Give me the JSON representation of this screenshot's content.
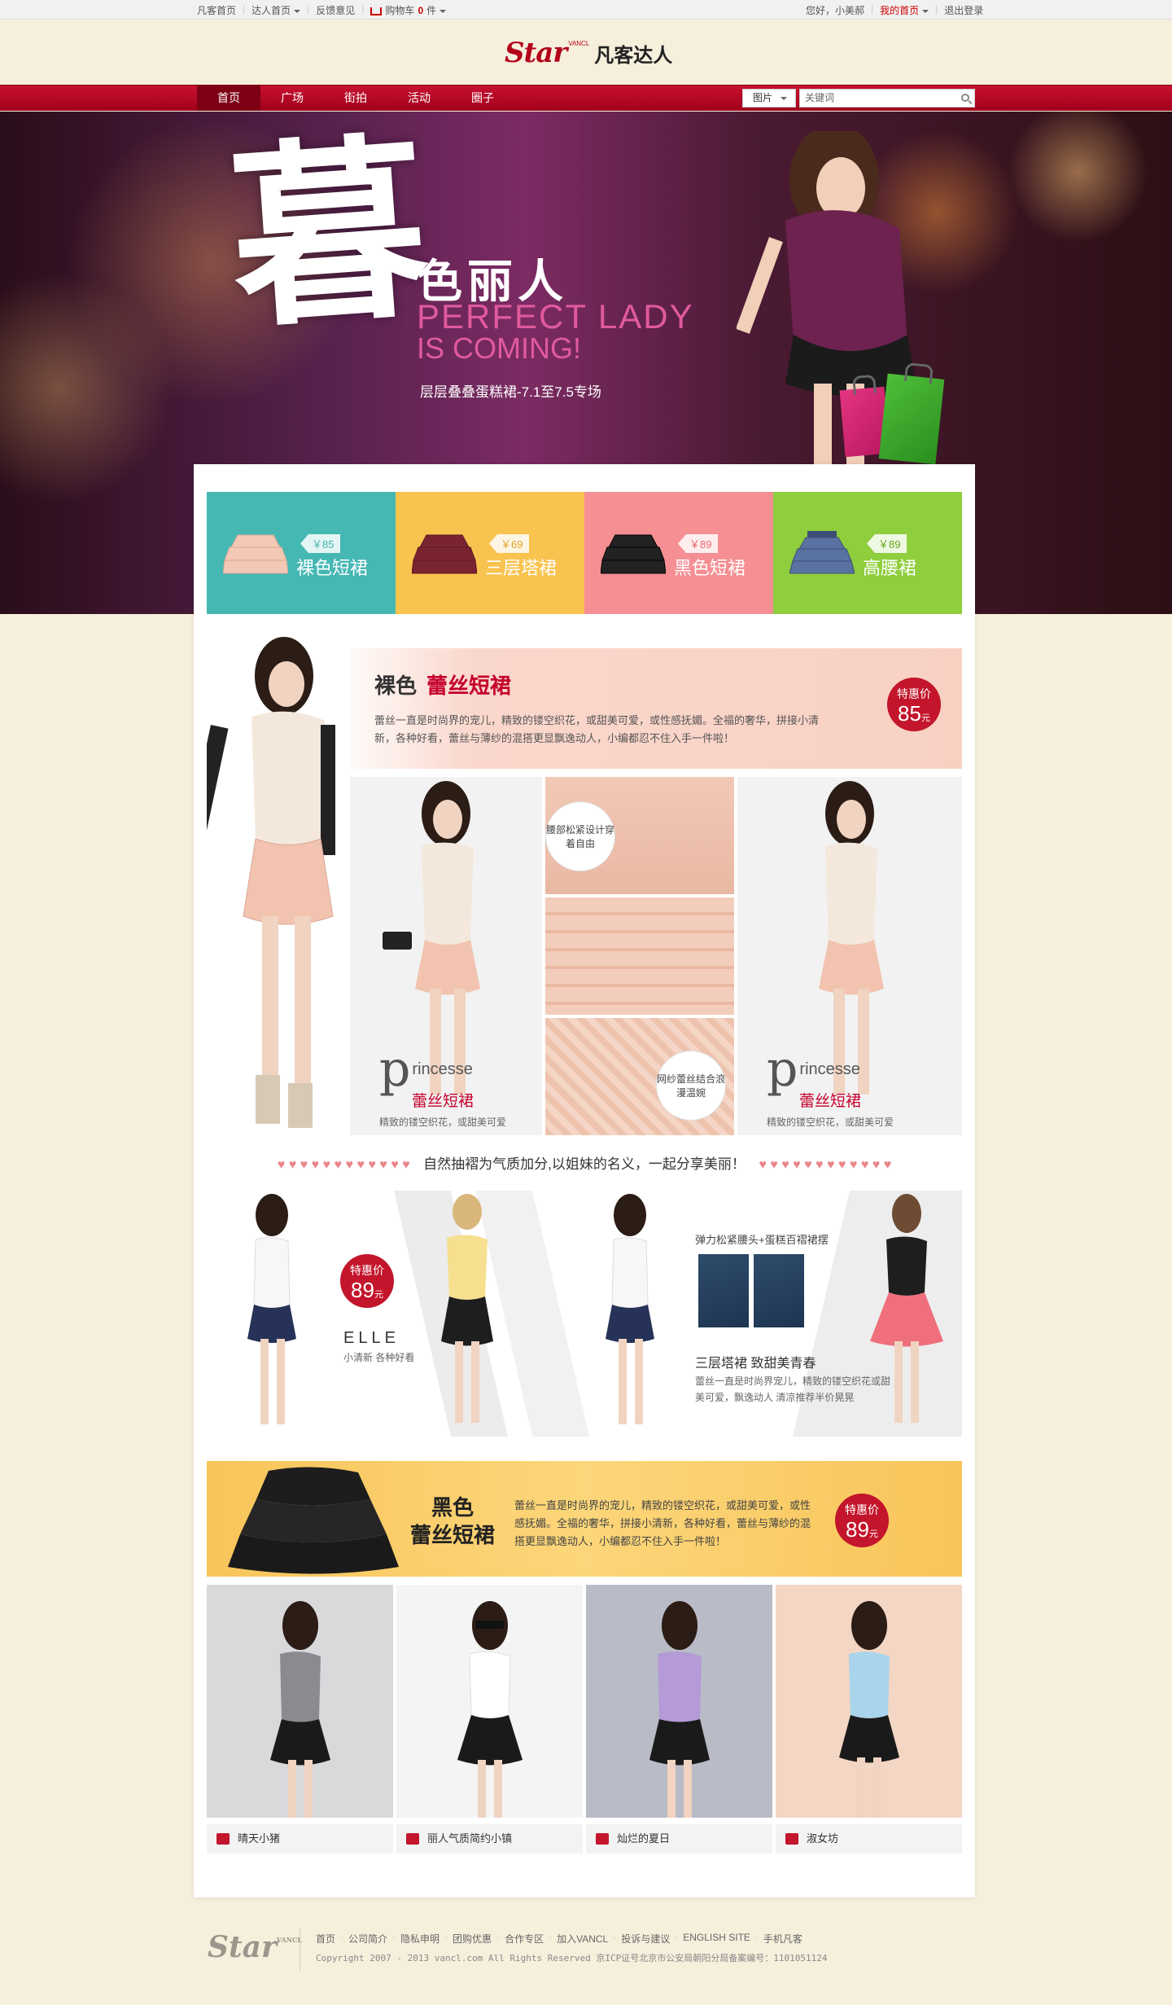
{
  "topbar": {
    "left": [
      "凡客首页",
      "达人首页",
      "反馈意见",
      "购物车",
      "0",
      "件"
    ],
    "right": [
      "您好，小美郝",
      "我的首页",
      "退出登录"
    ]
  },
  "logo": {
    "star": "Star",
    "vancl": "VANCL",
    "cn": "凡客达人"
  },
  "nav": {
    "items": [
      "首页",
      "广场",
      "街拍",
      "活动",
      "圈子"
    ],
    "search_type": "图片",
    "search_placeholder": "关键词"
  },
  "banner": {
    "big_char": "暮",
    "title": "色丽人",
    "en1": "PERFECT LADY",
    "en2": "IS COMING!",
    "subtitle": "层层叠叠蛋糕裙-7.1至7.5专场"
  },
  "tabs": [
    {
      "price": "￥85",
      "label": "裸色短裙",
      "bg": "#46b8b4",
      "skirt": "#f3c9b5"
    },
    {
      "price": "￥69",
      "label": "三层塔裙",
      "bg": "#f9c34f",
      "skirt": "#7b2431"
    },
    {
      "price": "￥89",
      "label": "黑色短裙",
      "bg": "#f58f93",
      "skirt": "#222222"
    },
    {
      "price": "￥89",
      "label": "高腰裙",
      "bg": "#8fce3d",
      "skirt": "#5a72a2"
    }
  ],
  "section1": {
    "title_a": "裸色",
    "title_b": "蕾丝短裙",
    "desc": "蕾丝一直是时尚界的宠儿，精致的镂空织花，或甜美可爱，或性感抚媚。全福的奢华，拼接小清新，各种好看，蕾丝与薄纱的混搭更显飘逸动人，小编都忍不住入手一件啦！",
    "badge_label": "特惠价",
    "badge_price": "85",
    "badge_unit": "元",
    "photo_cap_p": "p",
    "photo_cap_rincess": "rincesse",
    "photo_cap_main": "蕾丝短裙",
    "photo_cap_sub": "精致的镂空织花，或甜美可爱",
    "detail_tag1": "腰部松紧设计穿着自由",
    "detail_tag2": "网纱蕾丝结合浪漫温婉"
  },
  "hearts_text": "自然抽褶为气质加分,以姐妹的名义，一起分享美丽！",
  "section2": {
    "badge_label": "特惠价",
    "badge_price": "89",
    "badge_unit": "元",
    "elle": "ELLE",
    "elle_sub": "小清新 各种好看",
    "t1": "弹力松紧腰头+蛋糕百褶裙摆",
    "t2": "三层塔裙 致甜美青春",
    "t3": "蕾丝一直是时尚界宠儿，精致的镂空织花或甜美可爱，飘逸动人 清凉推荐半价晃晃"
  },
  "section3": {
    "title_a": "黑色",
    "title_b": "蕾丝短裙",
    "desc": "蕾丝一直是时尚界的宠儿，精致的镂空织花，或甜美可爱，或性感抚媚。全福的奢华，拼接小清新，各种好看，蕾丝与薄纱的混搭更显飘逸动人，小编都忍不住入手一件啦！",
    "badge_label": "特惠价",
    "badge_price": "89",
    "badge_unit": "元"
  },
  "cards": [
    {
      "name": "晴天小猪",
      "bg": "#d9d9dc",
      "top": "#8a8a90"
    },
    {
      "name": "丽人气质简约小镇",
      "bg": "#f4f4f4",
      "top": "#ffffff"
    },
    {
      "name": "灿烂的夏日",
      "bg": "#b9bcc6",
      "top": "#b49ad6"
    },
    {
      "name": "淑女坊",
      "bg": "#f3d6c4",
      "top": "#a9d4ec"
    }
  ],
  "footer": {
    "logo": "Star",
    "logo_small": "VANCL",
    "links": [
      "首页",
      "公司简介",
      "隐私申明",
      "团购优惠",
      "合作专区",
      "加入VANCL",
      "投诉与建议",
      "ENGLISH SITE",
      "手机凡客"
    ],
    "copyright": "Copyright 2007 - 2013 vancl.com All Rights Reserved 京ICP证号北京市公安局朝阳分局备案编号：1101051124"
  }
}
